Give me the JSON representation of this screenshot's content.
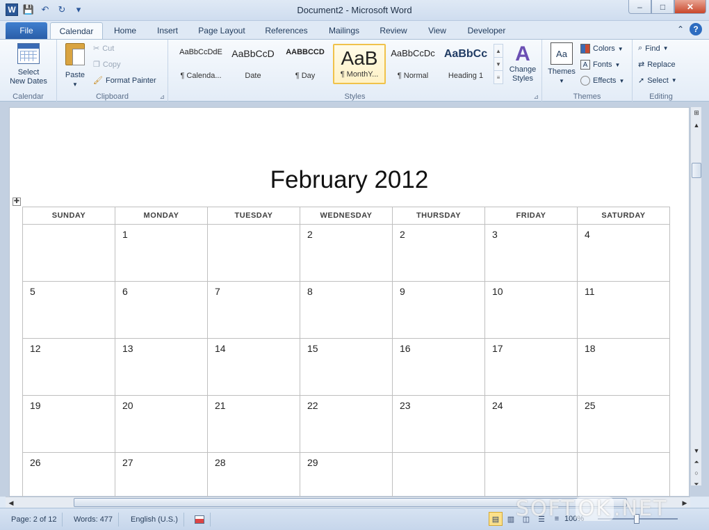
{
  "window": {
    "title": "Document2 - Microsoft Word",
    "app_icon": "W",
    "controls": {
      "minimize": "–",
      "maximize": "□",
      "close": "✕"
    }
  },
  "qat": {
    "save_icon": "💾",
    "undo_icon": "↶",
    "redo_icon": "↻",
    "customize_icon": "▾"
  },
  "tabs": {
    "file": "File",
    "items": [
      "Calendar",
      "Home",
      "Insert",
      "Page Layout",
      "References",
      "Mailings",
      "Review",
      "View",
      "Developer"
    ],
    "minimize_ribbon": "⌃",
    "help": "?"
  },
  "ribbon": {
    "calendar": {
      "select_dates": "Select",
      "select_dates_2": "New Dates",
      "label": "Calendar"
    },
    "clipboard": {
      "paste": "Paste",
      "cut": "Cut",
      "copy": "Copy",
      "format_painter": "Format Painter",
      "label": "Clipboard",
      "launcher": "⊿"
    },
    "styles": {
      "items": [
        {
          "sample": "AaBbCcDdE",
          "name": "¶ Calenda..."
        },
        {
          "sample": "AaBbCcD",
          "name": "Date"
        },
        {
          "sample": "AABBCCD",
          "name": "¶ Day"
        },
        {
          "sample": "AaB",
          "name": "¶ MonthY..."
        },
        {
          "sample": "AaBbCcDc",
          "name": "¶ Normal"
        },
        {
          "sample": "AaBbCc",
          "name": "Heading 1"
        }
      ],
      "change_styles": "Change",
      "change_styles_2": "Styles",
      "label": "Styles",
      "launcher": "⊿"
    },
    "themes": {
      "themes": "Themes",
      "colors": "Colors",
      "fonts": "Fonts",
      "effects": "Effects",
      "label": "Themes"
    },
    "editing": {
      "find": "Find",
      "replace": "Replace",
      "select": "Select",
      "label": "Editing"
    }
  },
  "document": {
    "title": "February 2012",
    "table_handle": "✚",
    "days": [
      "SUNDAY",
      "MONDAY",
      "TUESDAY",
      "WEDNESDAY",
      "THURSDAY",
      "FRIDAY",
      "SATURDAY"
    ],
    "weeks": [
      [
        "",
        "1",
        "",
        "2",
        "2",
        "3",
        "4"
      ],
      [
        "5",
        "6",
        "7",
        "8",
        "9",
        "10",
        "11"
      ],
      [
        "12",
        "13",
        "14",
        "15",
        "16",
        "17",
        "18"
      ],
      [
        "19",
        "20",
        "21",
        "22",
        "23",
        "24",
        "25"
      ],
      [
        "26",
        "27",
        "28",
        "29",
        "",
        "",
        ""
      ]
    ]
  },
  "statusbar": {
    "page": "Page: 2 of 12",
    "words": "Words: 477",
    "language": "English (U.S.)",
    "zoom": "100%",
    "zoom_level_pct": 50
  },
  "watermark": {
    "left": "SOFT",
    "mid": "OK",
    "right": ".NET"
  }
}
